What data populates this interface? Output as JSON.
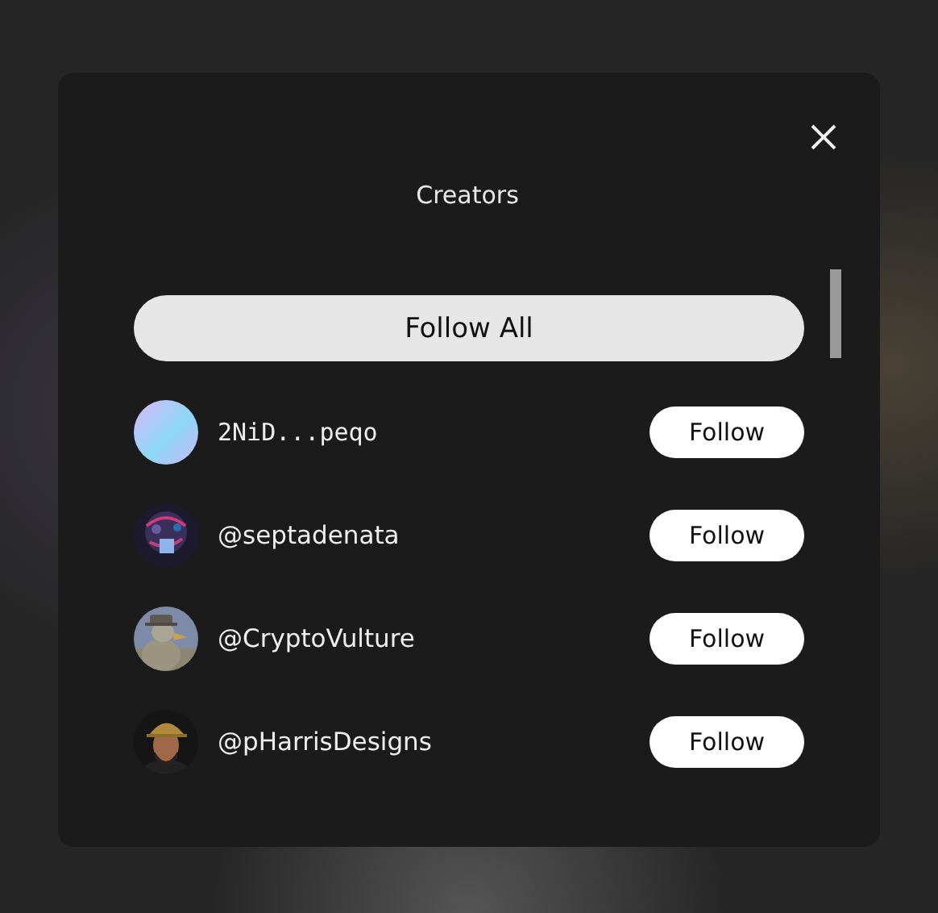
{
  "dialog": {
    "title": "Creators",
    "follow_all": "Follow All",
    "creators": [
      {
        "kind": "wallet",
        "name": "2NiD...peqo",
        "button": "Follow"
      },
      {
        "kind": "handle",
        "name": "@septadenata",
        "button": "Follow"
      },
      {
        "kind": "handle",
        "name": "@CryptoVulture",
        "button": "Follow"
      },
      {
        "kind": "handle",
        "name": "@pHarrisDesigns",
        "button": "Follow"
      }
    ]
  }
}
